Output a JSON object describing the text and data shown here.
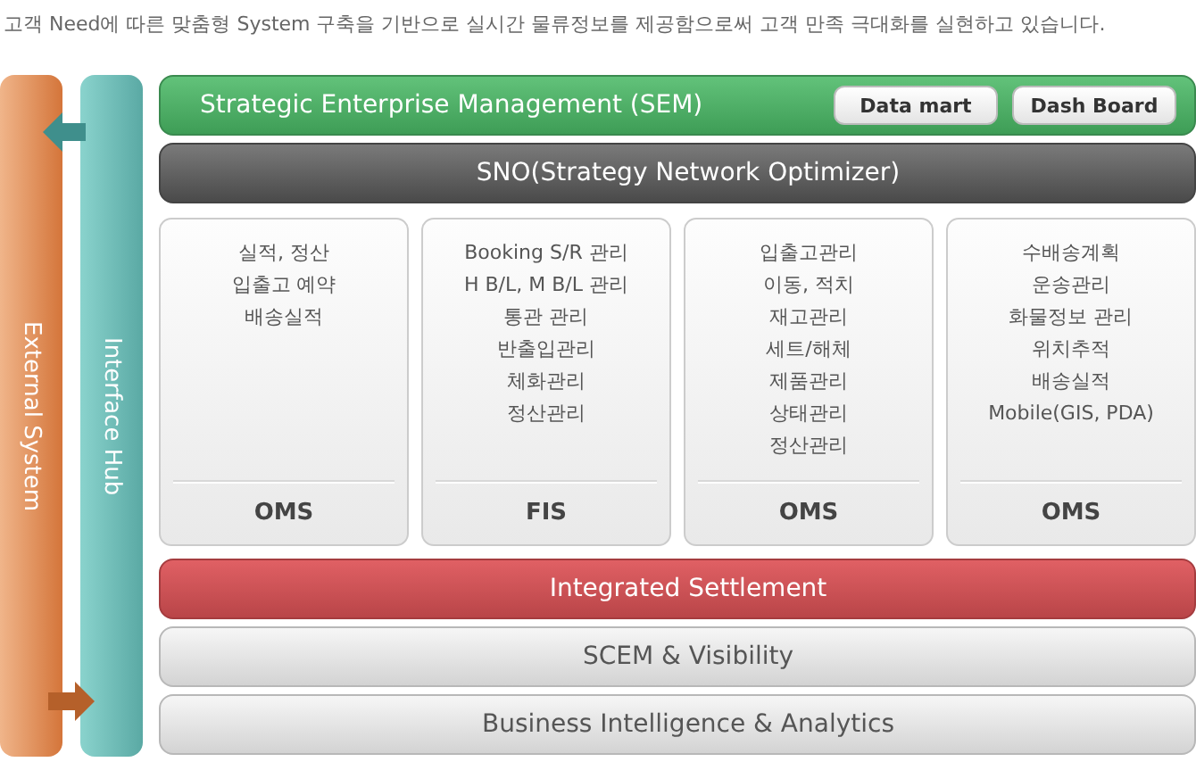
{
  "intro": "고객 Need에 따른 맞춤형 System 구축을 기반으로 실시간 물류정보를 제공함으로써 고객 만족 극대화를 실현하고 있습니다.",
  "side_columns": [
    {
      "kind": "external",
      "label": "External System"
    },
    {
      "kind": "hub",
      "label": "Interface Hub"
    }
  ],
  "top_bars": [
    {
      "kind": "sem",
      "label": "Strategic Enterprise Management (SEM)",
      "buttons": [
        "Data mart",
        "Dash Board"
      ]
    },
    {
      "kind": "optimizer",
      "label": "SNO(Strategy Network Optimizer)"
    }
  ],
  "modules": [
    {
      "items": [
        "실적, 정산",
        "입출고 예약",
        "배송실적"
      ],
      "label": "OMS"
    },
    {
      "items": [
        "Booking S/R 관리",
        "H B/L, M B/L 관리",
        "통관 관리",
        "반출입관리",
        "체화관리",
        "정산관리"
      ],
      "label": "FIS"
    },
    {
      "items": [
        "입출고관리",
        "이동, 적치",
        "재고관리",
        "세트/해체",
        "제품관리",
        "상태관리",
        "정산관리"
      ],
      "label": "OMS"
    },
    {
      "items": [
        "수배송계획",
        "운송관리",
        "화물정보 관리",
        "위치추적",
        "배송실적",
        "Mobile(GIS, PDA)"
      ],
      "label": "OMS"
    }
  ],
  "bottom_bars": [
    {
      "kind": "settlement",
      "label": "Integrated Settlement"
    },
    {
      "kind": "layer",
      "label": "SCEM & Visibility"
    },
    {
      "kind": "layer",
      "label": "Business Intelligence & Analytics"
    }
  ]
}
